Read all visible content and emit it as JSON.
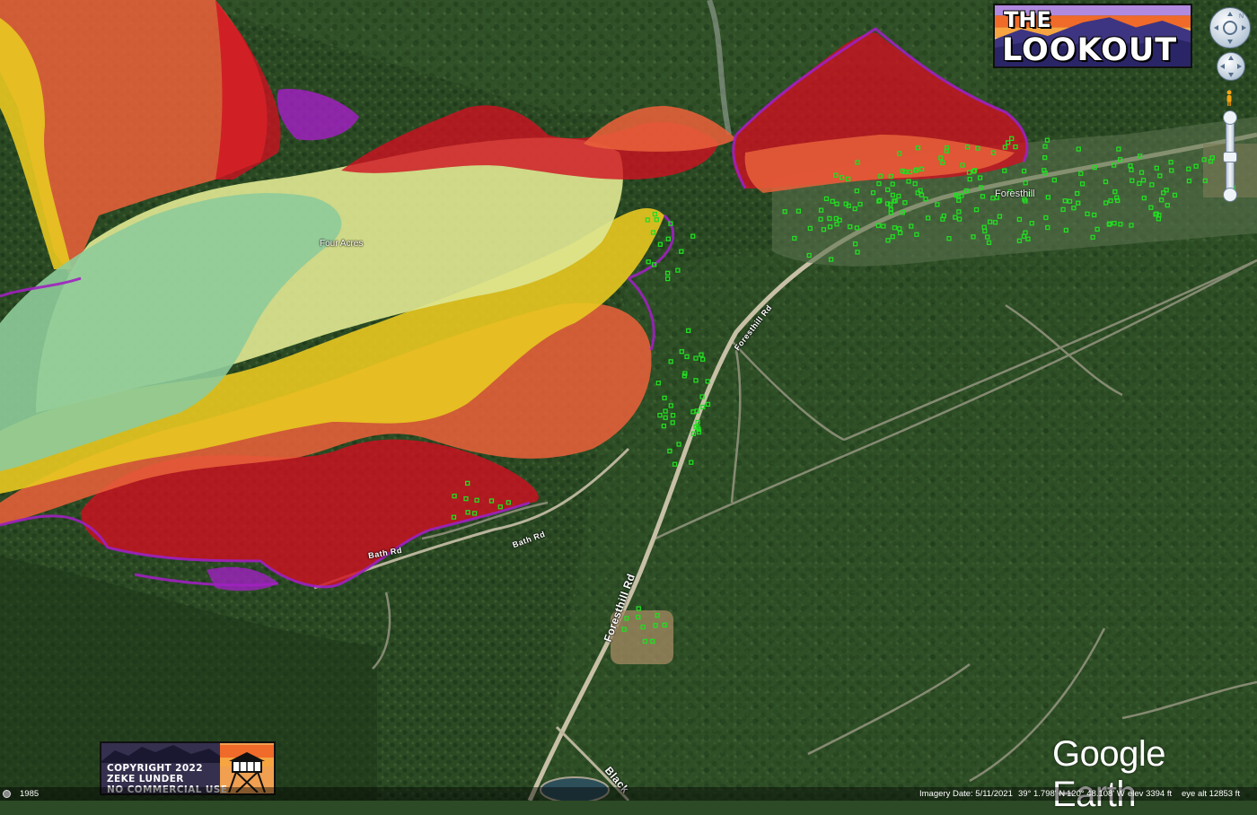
{
  "map": {
    "place_labels": {
      "four_acres": "Four Acres",
      "foresthill": "Foresthill"
    },
    "road_labels": {
      "foresthill_rd_upper": "Foresthill Rd",
      "foresthill_rd_lower": "Foresthill Rd",
      "bath_rd_upper": "Bath Rd",
      "bath_rd_lower": "Bath Rd",
      "blackhawk": "Black"
    },
    "colors": {
      "terrain_forest": "#2b4a24",
      "severity_purple": "#a020c0",
      "severity_red": "#d01020",
      "severity_orange": "#e8603a",
      "severity_yellow": "#e8c820",
      "severity_lightyellow": "#dde590",
      "severity_green": "#8ecb9a",
      "structure_marker": "#22dd22"
    }
  },
  "overlays": {
    "logo": {
      "line1": "THE",
      "line2": "LOOKOUT"
    },
    "copyright": {
      "line1": "COPYRIGHT 2022",
      "line2": "ZEKE LUNDER",
      "line3": "NO COMMERCIAL USE"
    },
    "brand": "Google Earth"
  },
  "nav_controls": {
    "look_icon": "look-joystick-icon",
    "move_icon": "move-joystick-icon",
    "streetview_icon": "pegman-icon",
    "zoom_icon": "zoom-slider-icon"
  },
  "status_bar": {
    "historical_year": "1985",
    "imagery_date": "Imagery Date: 5/11/2021",
    "lat": "39° 1.798' N",
    "lon": "120° 48.108' W",
    "elev": "elev  3394 ft",
    "eye_alt": "eye alt  12853 ft"
  }
}
